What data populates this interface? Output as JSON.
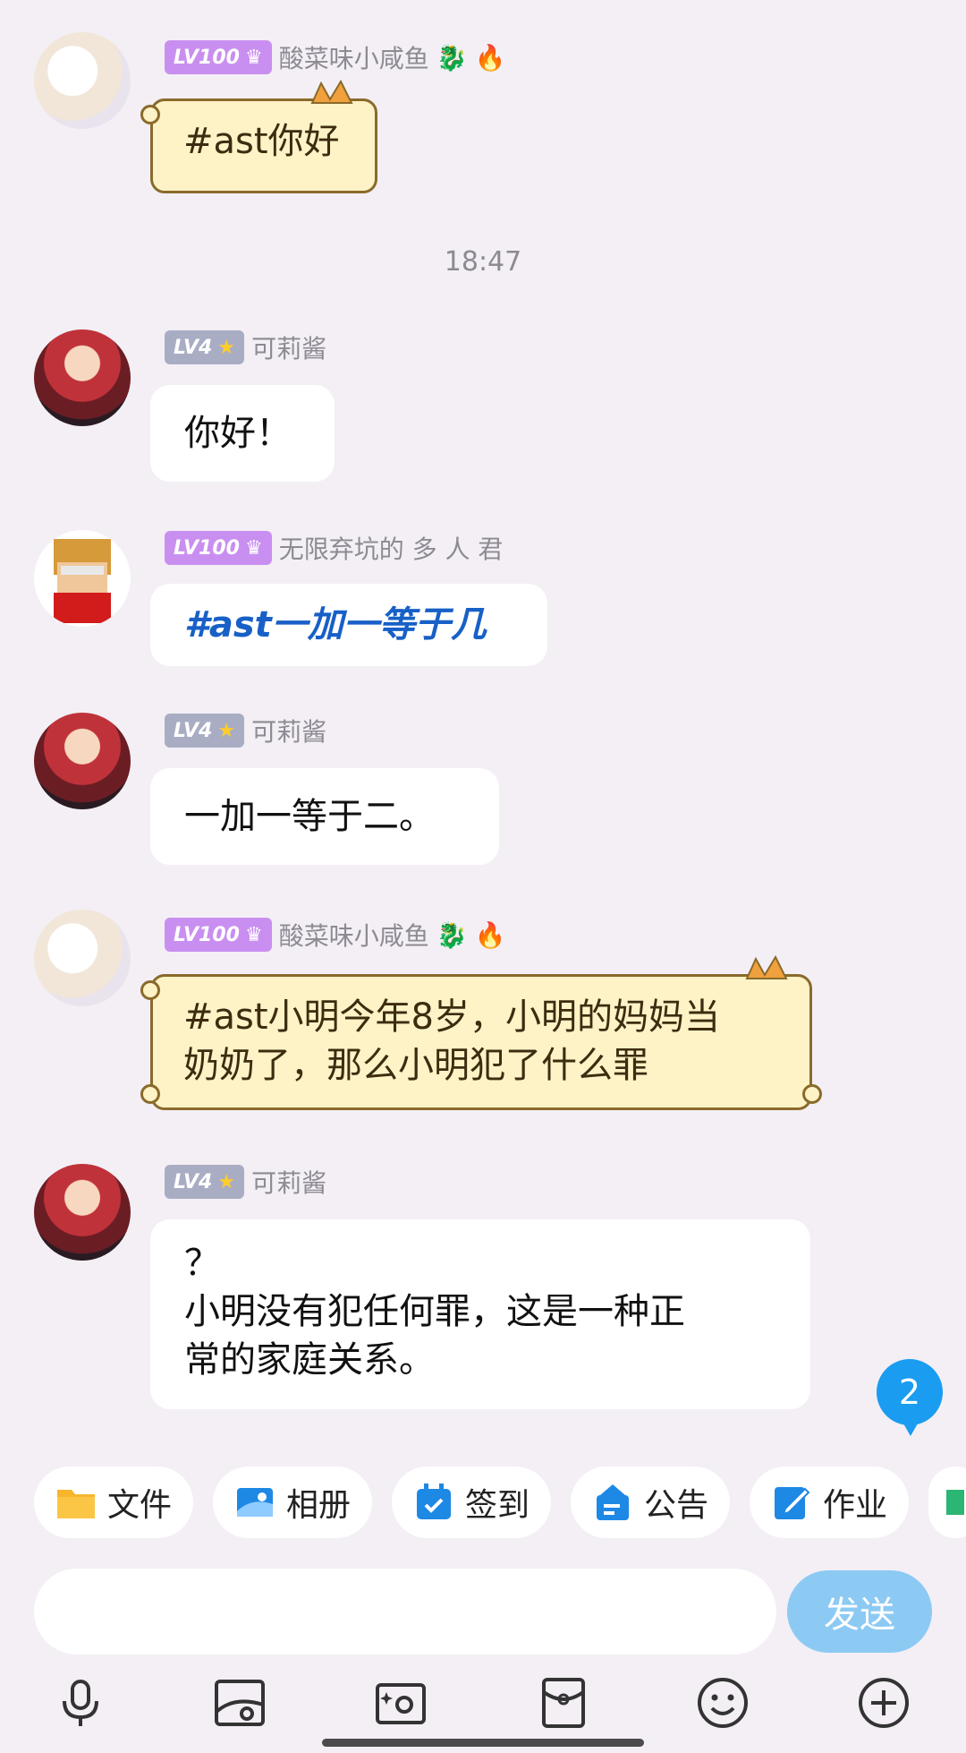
{
  "messages": [
    {
      "user": "酸菜味小咸鱼",
      "level": "LV100",
      "text": "#ast你好"
    },
    {
      "user": "可莉酱",
      "level": "LV4",
      "text": "你好！"
    },
    {
      "user": "无限弃坑的 多 人 君",
      "level": "LV100",
      "text": "#ast一加一等于几"
    },
    {
      "user": "可莉酱",
      "level": "LV4",
      "text": "一加一等于二。"
    },
    {
      "user": "酸菜味小咸鱼",
      "level": "LV100",
      "text_lines": [
        "#ast小明今年8岁，小明的妈妈当",
        "奶奶了，那么小明犯了什么罪"
      ]
    },
    {
      "user": "可莉酱",
      "level": "LV4",
      "text_lines": [
        "？",
        "小明没有犯任何罪，这是一种正",
        "常的家庭关系。"
      ]
    }
  ],
  "timestamp": "18:47",
  "unread_count": "2",
  "toolbar": {
    "items": [
      {
        "label": "文件",
        "icon": "folder-icon"
      },
      {
        "label": "相册",
        "icon": "album-icon"
      },
      {
        "label": "签到",
        "icon": "checkin-icon"
      },
      {
        "label": "公告",
        "icon": "announcement-icon"
      },
      {
        "label": "作业",
        "icon": "homework-icon"
      }
    ]
  },
  "input": {
    "placeholder": "",
    "send_label": "发送"
  },
  "bottom_bar": [
    "microphone-icon",
    "image-icon",
    "camera-icon",
    "red-packet-icon",
    "emoji-icon",
    "plus-icon"
  ],
  "colors": {
    "accent": "#1a9cf0",
    "send_disabled": "#8ccaf4",
    "background": "#f3eff5",
    "cat_bubble": "#fdf3c6",
    "blue_text": "#1860c7",
    "badge_purple": "#c98ff0",
    "badge_grey": "#a9adc4"
  }
}
